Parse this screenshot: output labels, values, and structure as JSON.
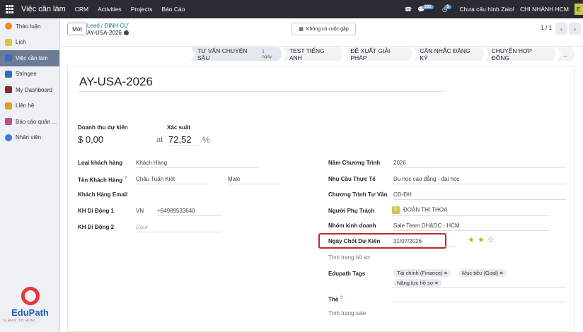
{
  "topbar": {
    "app_name": "Việc cần làm",
    "menus": [
      "CRM",
      "Activities",
      "Projects",
      "Báo Cáo"
    ],
    "chat_count": "202",
    "activity_count": "5",
    "zalo_status": "Chưa cấu hình Zalo!",
    "company": "CHI NHÁNH HCM",
    "avatar_letter": "E"
  },
  "sidebar": {
    "items": [
      {
        "label": "Thảo luận",
        "icon": "discuss-icon",
        "color": "#f08a24"
      },
      {
        "label": "Lịch",
        "icon": "calendar-icon",
        "color": "#e8c040"
      },
      {
        "label": "Việc cần làm",
        "icon": "todo-icon",
        "color": "#2f6fc1"
      },
      {
        "label": "Stringee",
        "icon": "stringee-icon",
        "color": "#2f6fc1"
      },
      {
        "label": "My Dashboard",
        "icon": "dashboard-icon",
        "color": "#8a2a2a"
      },
      {
        "label": "Liên hệ",
        "icon": "contacts-icon",
        "color": "#e0a020"
      },
      {
        "label": "Báo cáo quản ...",
        "icon": "report-icon",
        "color": "#c04d8a"
      },
      {
        "label": "Nhân viên",
        "icon": "employees-icon",
        "color": "#3a7bd5"
      }
    ],
    "active_index": 2,
    "logo_name": "EduPath",
    "logo_tagline": "A WAY TO WIN!"
  },
  "control": {
    "new_button": "Mới",
    "breadcrumb_parent": "Lead",
    "breadcrumb_sep": "/",
    "breadcrumb_stage": "ĐỊNH CƯ",
    "breadcrumb_current": "AY-USA-2026",
    "meeting_button": "Không có cuộc gặp",
    "pager": "1 / 1"
  },
  "stages": [
    {
      "label": "TƯ VẤN CHUYÊN SÂU",
      "count": "1 ngày",
      "active": true
    },
    {
      "label": "TEST TIẾNG ANH"
    },
    {
      "label": "ĐỀ XUẤT GIẢI PHÁP"
    },
    {
      "label": "CÂN NHẮC ĐĂNG KÝ"
    },
    {
      "label": "CHUYẾN HỢP ĐỒNG"
    },
    {
      "label": "..."
    }
  ],
  "form": {
    "title": "AY-USA-2026",
    "revenue_label": "Doanh thu dự kiến",
    "revenue_value": "$ 0,00",
    "at_label": "at",
    "probability_label": "Xác suất",
    "probability_value": "72,52",
    "percent_sign": "%",
    "left": {
      "customer_type_label": "Loại khách hàng",
      "customer_type_value": "Khách Hàng",
      "customer_name_label": "Tên Khách Hàng",
      "help_mark": "?",
      "customer_name_value": "Châu Tuấn Kiệt",
      "gender_value": "Male",
      "email_label": "Khách Hàng Email",
      "mobile1_label": "KH Di Động 1",
      "mobile1_country": "VN",
      "mobile1_value": "+84989533640",
      "mobile2_label": "KH Di Động 2",
      "mobile2_placeholder": "Cour"
    },
    "right": {
      "program_year_label": "Năm Chương Trình",
      "program_year_value": "2026",
      "need_label": "Nhu Cầu Thực Tế",
      "need_value": "Du học cao đẳng - đại học",
      "program_label": "Chương Trình Tư Vấn",
      "program_value": "CĐ-ĐH",
      "owner_label": "Người Phụ Trách",
      "owner_avatar": "Đ",
      "owner_value": "ĐOÀN THỊ THOA",
      "team_label": "Nhóm kinh doanh",
      "team_value": "Sale Team DH&DC - HCM",
      "close_date_label": "Ngày Chốt Dự Kiến",
      "close_date_value": "31/07/2026",
      "profile_status_label": "Tình trạng hồ sơ",
      "tags_label": "Edupath Tags",
      "tags": [
        "Tài chính (Finance)",
        "Mục tiêu (Goal)",
        "Năng lực hồ sơ"
      ],
      "the_label": "Thẻ",
      "sale_status_label": "Tình trạng sale",
      "priority_stars": 2,
      "priority_max": 3
    }
  }
}
